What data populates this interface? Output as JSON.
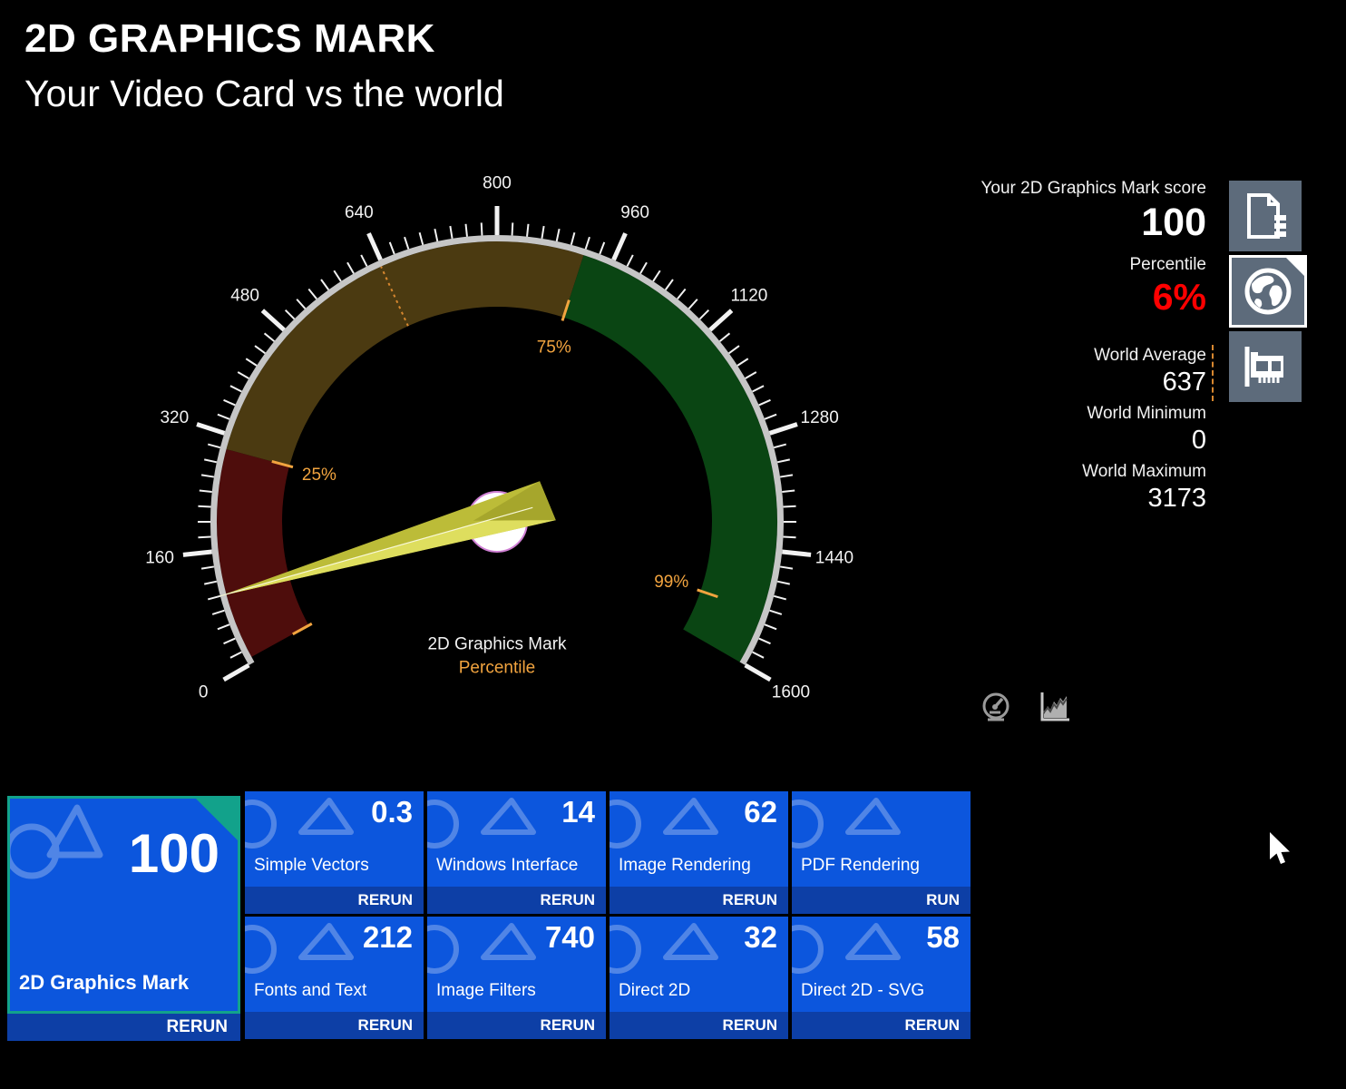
{
  "header": {
    "title": "2D GRAPHICS MARK",
    "subtitle": "Your Video Card vs the world"
  },
  "stats": {
    "score_label": "Your 2D Graphics Mark score",
    "score_value": "100",
    "percentile_label": "Percentile",
    "percentile_value": "6%",
    "world_average_label": "World Average",
    "world_average_value": "637",
    "world_minimum_label": "World Minimum",
    "world_minimum_value": "0",
    "world_maximum_label": "World Maximum",
    "world_maximum_value": "3173"
  },
  "chart_data": {
    "type": "gauge",
    "title": "2D Graphics Mark",
    "subtitle": "Percentile",
    "min": 0,
    "max": 1600,
    "major_tick_step": 160,
    "minor_tick_step": 20,
    "needle_value": 100,
    "tick_labels": [
      "0",
      "160",
      "320",
      "480",
      "640",
      "800",
      "960",
      "1120",
      "1280",
      "1440",
      "1600"
    ],
    "arcs": [
      {
        "from": 8,
        "to": 300,
        "color": "#4e0d0c"
      },
      {
        "from": 300,
        "to": 920,
        "color": "#4b3a11"
      },
      {
        "from": 920,
        "to": 1600,
        "color": "#0a4513"
      }
    ],
    "percentile_markers": [
      {
        "label": "",
        "value": 8
      },
      {
        "label": "25%",
        "value": 300
      },
      {
        "label": "75%",
        "value": 920
      },
      {
        "label": "99%",
        "value": 1525
      }
    ],
    "world_average_marker": {
      "value": 637
    }
  },
  "tiles": {
    "main": {
      "value": "100",
      "label": "2D Graphics Mark",
      "action": "RERUN"
    },
    "items": [
      {
        "value": "0.3",
        "label": "Simple Vectors",
        "action": "RERUN"
      },
      {
        "value": "14",
        "label": "Windows Interface",
        "action": "RERUN"
      },
      {
        "value": "62",
        "label": "Image Rendering",
        "action": "RERUN"
      },
      {
        "value": "",
        "label": "PDF Rendering",
        "action": "RUN"
      },
      {
        "value": "212",
        "label": "Fonts and Text",
        "action": "RERUN"
      },
      {
        "value": "740",
        "label": "Image Filters",
        "action": "RERUN"
      },
      {
        "value": "32",
        "label": "Direct 2D",
        "action": "RERUN"
      },
      {
        "value": "58",
        "label": "Direct 2D - SVG",
        "action": "RERUN"
      }
    ]
  },
  "side_buttons": [
    {
      "icon": "report-icon"
    },
    {
      "icon": "globe-icon",
      "selected": true
    },
    {
      "icon": "graphics-card-icon"
    }
  ],
  "colors": {
    "background": "#000000",
    "tile_blue": "#0c56dd",
    "action_bar_blue": "#0d3fa6",
    "tile_border_teal": "#12a28b",
    "button_slate": "#5d6b7b",
    "orange_accent": "#f2a43f",
    "average_dash_orange": "#d7872f",
    "percentile_red": "#ff0000",
    "needle_yellow": "#c9c93e",
    "gauge_rim_silver": "#c6c6c6"
  }
}
